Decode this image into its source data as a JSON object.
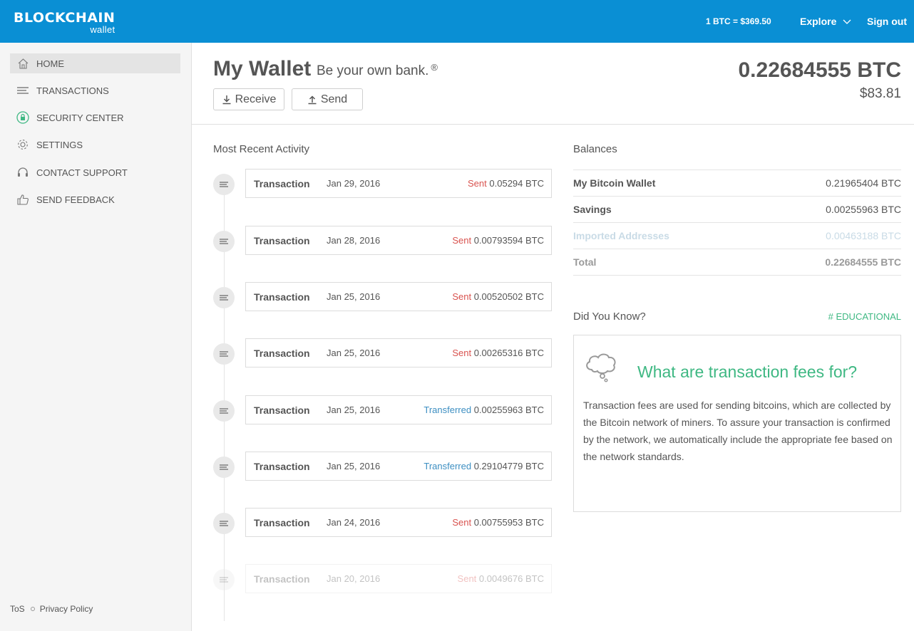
{
  "topbar": {
    "logo_main": "BLOCKCHAIN",
    "logo_sub": "wallet",
    "rate": "1 BTC = $369.50",
    "explore": "Explore",
    "signout": "Sign out",
    "color": "#0a8fd4"
  },
  "sidebar": {
    "items": [
      {
        "label": "HOME",
        "icon": "home-icon",
        "active": true
      },
      {
        "label": "TRANSACTIONS",
        "icon": "list-icon"
      },
      {
        "label": "SECURITY CENTER",
        "icon": "lock-icon"
      },
      {
        "label": "SETTINGS",
        "icon": "gear-icon"
      },
      {
        "label": "CONTACT SUPPORT",
        "icon": "headset-icon"
      },
      {
        "label": "SEND FEEDBACK",
        "icon": "thumbs-up-icon"
      }
    ],
    "footer": {
      "tos": "ToS",
      "privacy": "Privacy Policy"
    }
  },
  "header": {
    "title": "My Wallet",
    "tagline": "Be your own bank.",
    "tagline_mark": "®",
    "receive": "Receive",
    "send": "Send",
    "balance_btc": "0.22684555 BTC",
    "balance_usd": "$83.81"
  },
  "activity": {
    "title": "Most Recent Activity",
    "items": [
      {
        "type": "Transaction",
        "date": "Jan 29, 2016",
        "status": "Sent",
        "amount": "0.05294 BTC"
      },
      {
        "type": "Transaction",
        "date": "Jan 28, 2016",
        "status": "Sent",
        "amount": "0.00793594 BTC"
      },
      {
        "type": "Transaction",
        "date": "Jan 25, 2016",
        "status": "Sent",
        "amount": "0.00520502 BTC"
      },
      {
        "type": "Transaction",
        "date": "Jan 25, 2016",
        "status": "Sent",
        "amount": "0.00265316 BTC"
      },
      {
        "type": "Transaction",
        "date": "Jan 25, 2016",
        "status": "Transferred",
        "amount": "0.00255963 BTC"
      },
      {
        "type": "Transaction",
        "date": "Jan 25, 2016",
        "status": "Transferred",
        "amount": "0.29104779 BTC"
      },
      {
        "type": "Transaction",
        "date": "Jan 24, 2016",
        "status": "Sent",
        "amount": "0.00755953 BTC"
      },
      {
        "type": "Transaction",
        "date": "Jan 20, 2016",
        "status": "Sent",
        "amount": "0.0049676 BTC"
      }
    ]
  },
  "balances": {
    "title": "Balances",
    "rows": [
      {
        "label": "My Bitcoin Wallet",
        "value": "0.21965404 BTC"
      },
      {
        "label": "Savings",
        "value": "0.00255963 BTC"
      },
      {
        "label": "Imported Addresses",
        "value": "0.00463188 BTC"
      },
      {
        "label": "Total",
        "value": "0.22684555 BTC"
      }
    ]
  },
  "did_you_know": {
    "title": "Did You Know?",
    "tag": "# EDUCATIONAL",
    "heading": "What are transaction fees for?",
    "text": "Transaction fees are used for sending bitcoins, which are collected by the Bitcoin network of miners. To assure your transaction is confirmed by the network, we automatically include the appropriate fee based on the network standards.",
    "accent": "#3fb883"
  },
  "colors": {
    "sent": "#d9534f",
    "transferred": "#3d8fc2"
  }
}
